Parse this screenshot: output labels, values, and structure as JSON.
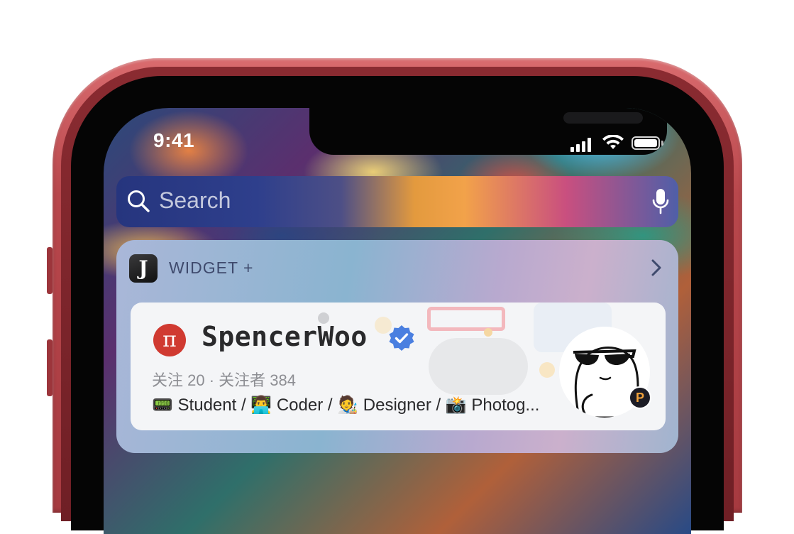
{
  "status_bar": {
    "time": "9:41",
    "icons": [
      "cellular-signal-icon",
      "wifi-icon",
      "battery-icon"
    ]
  },
  "search": {
    "placeholder": "Search",
    "icon": "search-icon",
    "mic_icon": "microphone-icon"
  },
  "widget": {
    "title": "WIDGET +",
    "app_icon_letter": "J",
    "profile": {
      "badge_glyph": "π",
      "username": "SpencerWoo",
      "verified_icon": "verified-badge-icon",
      "counts": "关注 20 · 关注者 384",
      "bio": "📟 Student / 👨‍💻 Coder / 🧑‍🎨 Designer / 📸 Photog...",
      "platform_badge": "P"
    }
  },
  "colors": {
    "frame": "#b8474c",
    "verified": "#4a7fe0",
    "avatar_badge": "#d03a31"
  }
}
